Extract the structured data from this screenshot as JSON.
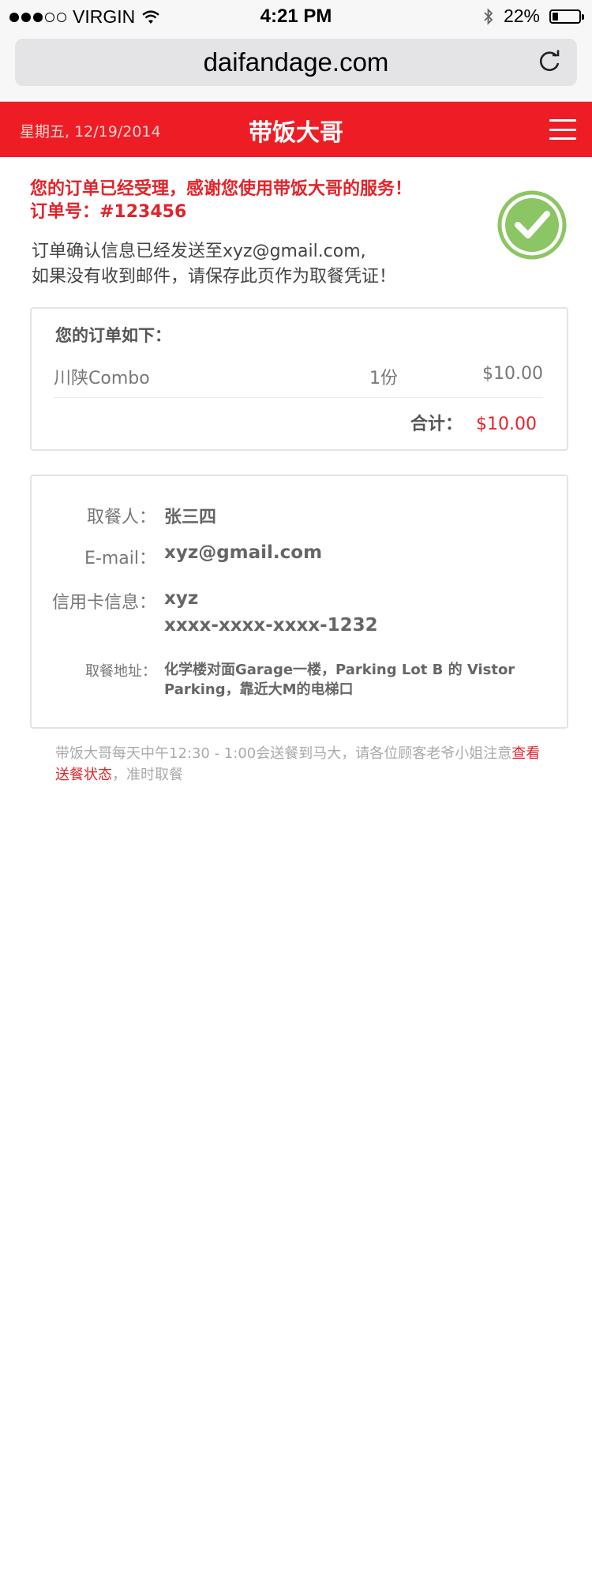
{
  "status_bar": {
    "carrier": "VIRGIN",
    "time": "4:21 PM",
    "battery": "22%",
    "battery_level": 0.22,
    "icons": [
      "signal-dots-icon",
      "wifi-icon",
      "bluetooth-icon",
      "battery-icon"
    ]
  },
  "browser": {
    "url": "daifandage.com",
    "reload_icon": "reload-icon"
  },
  "header": {
    "date": "星期五, 12/19/2014",
    "title": "带饭大哥",
    "menu_icon": "hamburger-menu-icon",
    "bg_color": "#ee1d25"
  },
  "confirmation": {
    "title": "您的订单已经受理，感谢您使用带饭大哥的服务！",
    "order_number": "订单号：#123456",
    "message_line1": "订单确认信息已经发送至xyz@gmail.com,",
    "message_line2": "如果没有收到邮件，请保存此页作为取餐凭证！",
    "icon": "check-circle-icon"
  },
  "order": {
    "heading": "您的订单如下：",
    "items": [
      {
        "name": "川陕Combo",
        "qty": "1份",
        "price": "$10.00"
      }
    ],
    "total_label": "合计：",
    "total_value": "$10.00"
  },
  "pickup": {
    "name_label": "取餐人：",
    "name_value": "张三四",
    "email_label": "E-mail：",
    "email_value": "xyz@gmail.com",
    "card_label": "信用卡信息：",
    "card_name": "xyz",
    "card_number": "xxxx-xxxx-xxxx-1232",
    "address_label": "取餐地址：",
    "address_value": "化学楼对面Garage一楼，Parking Lot B 的 Vistor Parking，靠近大M的电梯口"
  },
  "notice": {
    "text_before": "带饭大哥每天中午12:30 - 1:00会送餐到马大，请各位顾客老爷小姐注意",
    "link_text": "查看送餐状态",
    "text_after": "，准时取餐"
  },
  "colors": {
    "accent": "#e3232a",
    "check_green": "#8cc563"
  }
}
